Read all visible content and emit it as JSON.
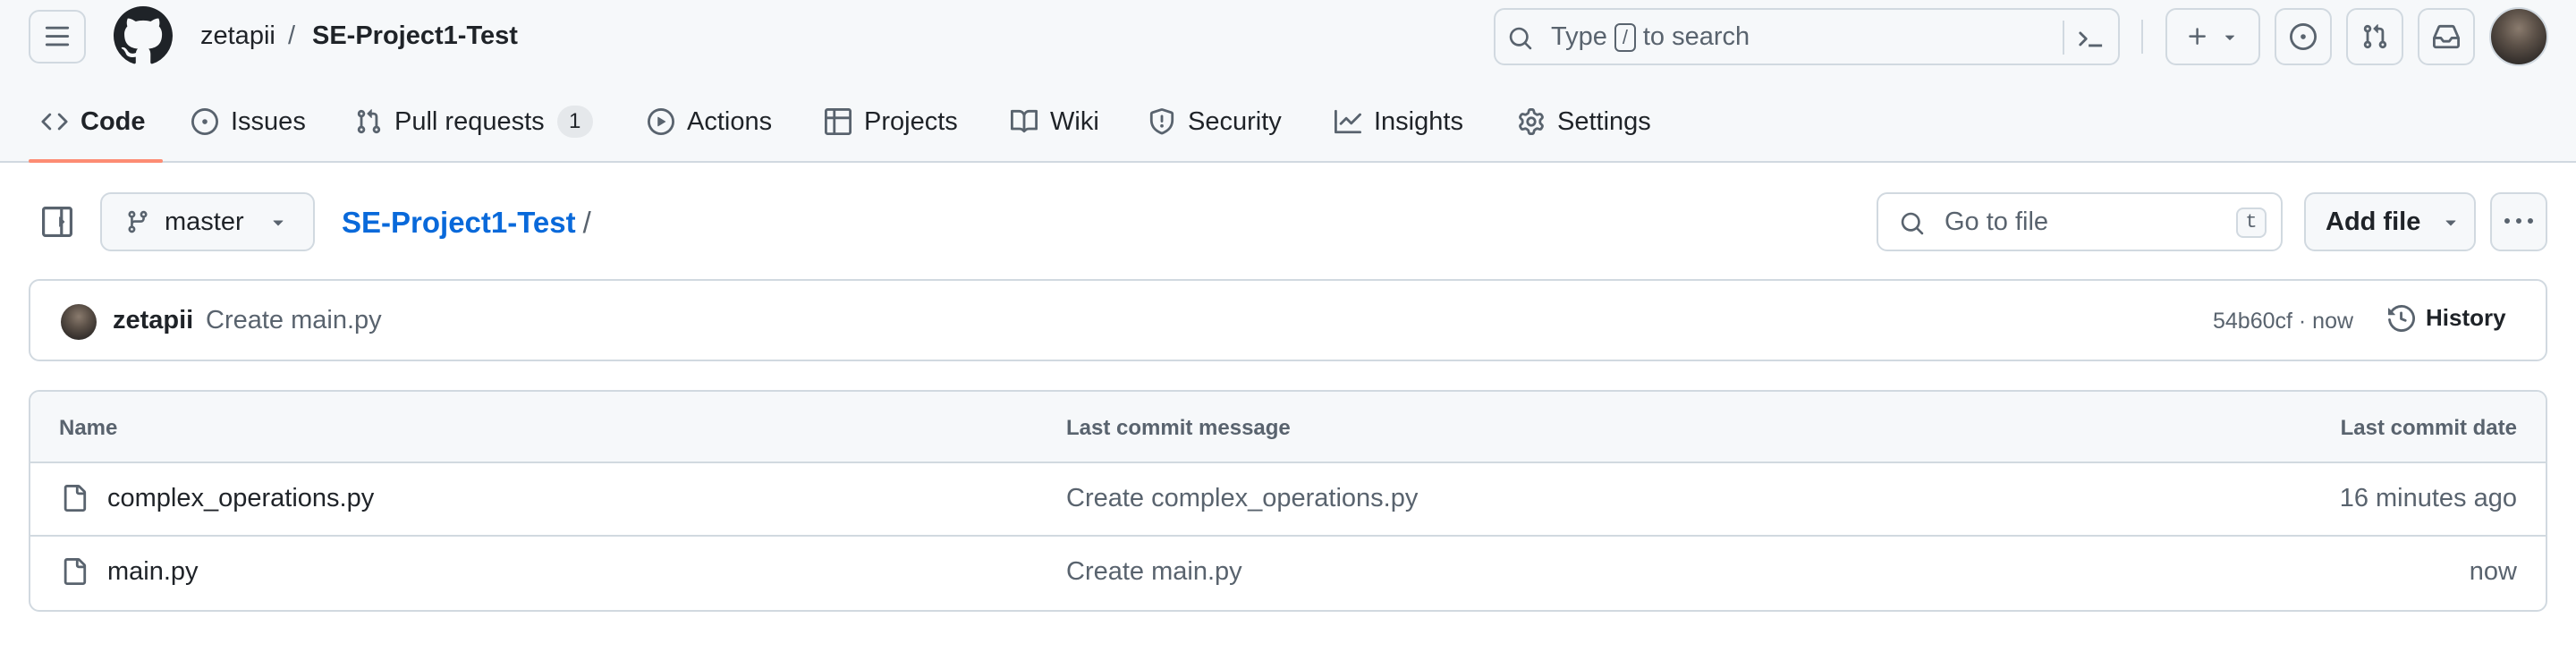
{
  "header": {
    "owner": "zetapii",
    "separator": "/",
    "repo": "SE-Project1-Test",
    "search": {
      "prefix": "Type",
      "key": "/",
      "suffix": "to search"
    }
  },
  "repo_nav": {
    "items": [
      {
        "label": "Code",
        "icon": "code-icon",
        "active": true
      },
      {
        "label": "Issues",
        "icon": "issue-opened-icon"
      },
      {
        "label": "Pull requests",
        "icon": "git-pull-request-icon",
        "count": "1"
      },
      {
        "label": "Actions",
        "icon": "play-icon"
      },
      {
        "label": "Projects",
        "icon": "table-icon"
      },
      {
        "label": "Wiki",
        "icon": "book-icon"
      },
      {
        "label": "Security",
        "icon": "shield-icon"
      },
      {
        "label": "Insights",
        "icon": "graph-icon"
      },
      {
        "label": "Settings",
        "icon": "gear-icon"
      }
    ]
  },
  "toolbar": {
    "branch": "master",
    "path_repo": "SE-Project1-Test",
    "path_sep": "/",
    "goto_placeholder": "Go to file",
    "goto_key": "t",
    "add_file": "Add file"
  },
  "commit": {
    "author": "zetapii",
    "message": "Create main.py",
    "meta": "54b60cf · now",
    "history": "History"
  },
  "files": {
    "headers": {
      "name": "Name",
      "message": "Last commit message",
      "date": "Last commit date"
    },
    "rows": [
      {
        "name": "complex_operations.py",
        "message": "Create complex_operations.py",
        "date": "16 minutes ago"
      },
      {
        "name": "main.py",
        "message": "Create main.py",
        "date": "now"
      }
    ]
  },
  "colors": {
    "accent_link": "#0969da",
    "nav_underline": "#fd8c73",
    "border": "#d1d9e0",
    "muted_text": "#59636e"
  }
}
